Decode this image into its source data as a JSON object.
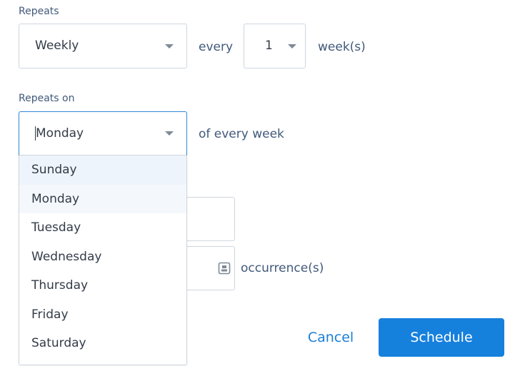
{
  "repeats": {
    "label": "Repeats",
    "frequency_value": "Weekly",
    "every_text": "every",
    "interval_value": "1",
    "unit_text": "week(s)"
  },
  "repeats_on": {
    "label": "Repeats on",
    "selected_value": "Monday",
    "suffix_text": "of every week",
    "options": [
      "Sunday",
      "Monday",
      "Tuesday",
      "Wednesday",
      "Thursday",
      "Friday",
      "Saturday"
    ],
    "hovered_option": "Sunday"
  },
  "ends": {
    "occurrences_text": "occurrence(s)",
    "calendar_icon": "calendar-icon"
  },
  "actions": {
    "cancel_label": "Cancel",
    "schedule_label": "Schedule"
  },
  "colors": {
    "accent": "#1680dd",
    "label": "#41597a",
    "focus_border": "#2f86d6"
  }
}
